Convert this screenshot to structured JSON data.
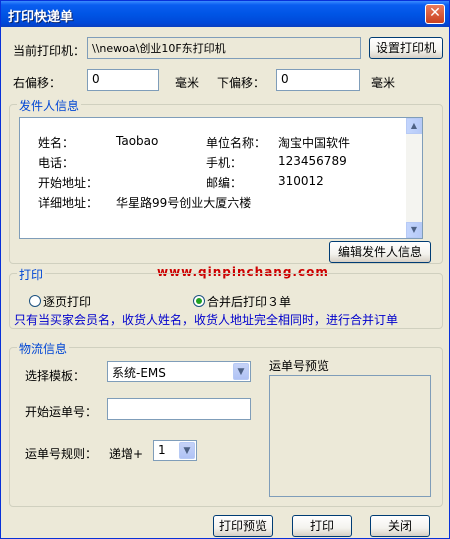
{
  "window": {
    "title": "打印快递单",
    "close_glyph": "✕"
  },
  "printer": {
    "label": "当前打印机：",
    "value": "\\\\newoa\\创业10F东打印机",
    "button": "设置打印机"
  },
  "offsets": {
    "right_label": "右偏移：",
    "right_value": "0",
    "right_unit": "毫米",
    "down_label": "下偏移：",
    "down_value": "0",
    "down_unit": "毫米"
  },
  "sender": {
    "legend": "发件人信息",
    "name_label": "姓名：",
    "name_value": "Taobao",
    "company_label": "单位名称：",
    "company_value": "淘宝中国软件",
    "phone_label": "电话：",
    "phone_value": "",
    "mobile_label": "手机：",
    "mobile_value": "123456789",
    "start_label": "开始地址：",
    "start_value": "",
    "zip_label": "邮编：",
    "zip_value": "310012",
    "address_label": "详细地址：",
    "address_value": "华星路99号创业大厦六楼",
    "edit_button": "编辑发件人信息"
  },
  "watermark": "www.qinpinchang.com",
  "print": {
    "legend": "打印",
    "option1": "逐页打印",
    "option2": "合并后打印３单",
    "selected": "option2",
    "note": "只有当买家会员名，收货人姓名，收货人地址完全相同时，进行合并订单"
  },
  "logistics": {
    "legend": "物流信息",
    "template_label": "选择模板：",
    "template_value": "系统-EMS",
    "start_no_label": "开始运单号：",
    "start_no_value": "",
    "rule_label": "运单号规则：",
    "rule_prefix": "递增+",
    "rule_value": "1",
    "preview_label": "运单号预览"
  },
  "buttons": {
    "preview": "打印预览",
    "print": "打印",
    "close": "关闭"
  }
}
